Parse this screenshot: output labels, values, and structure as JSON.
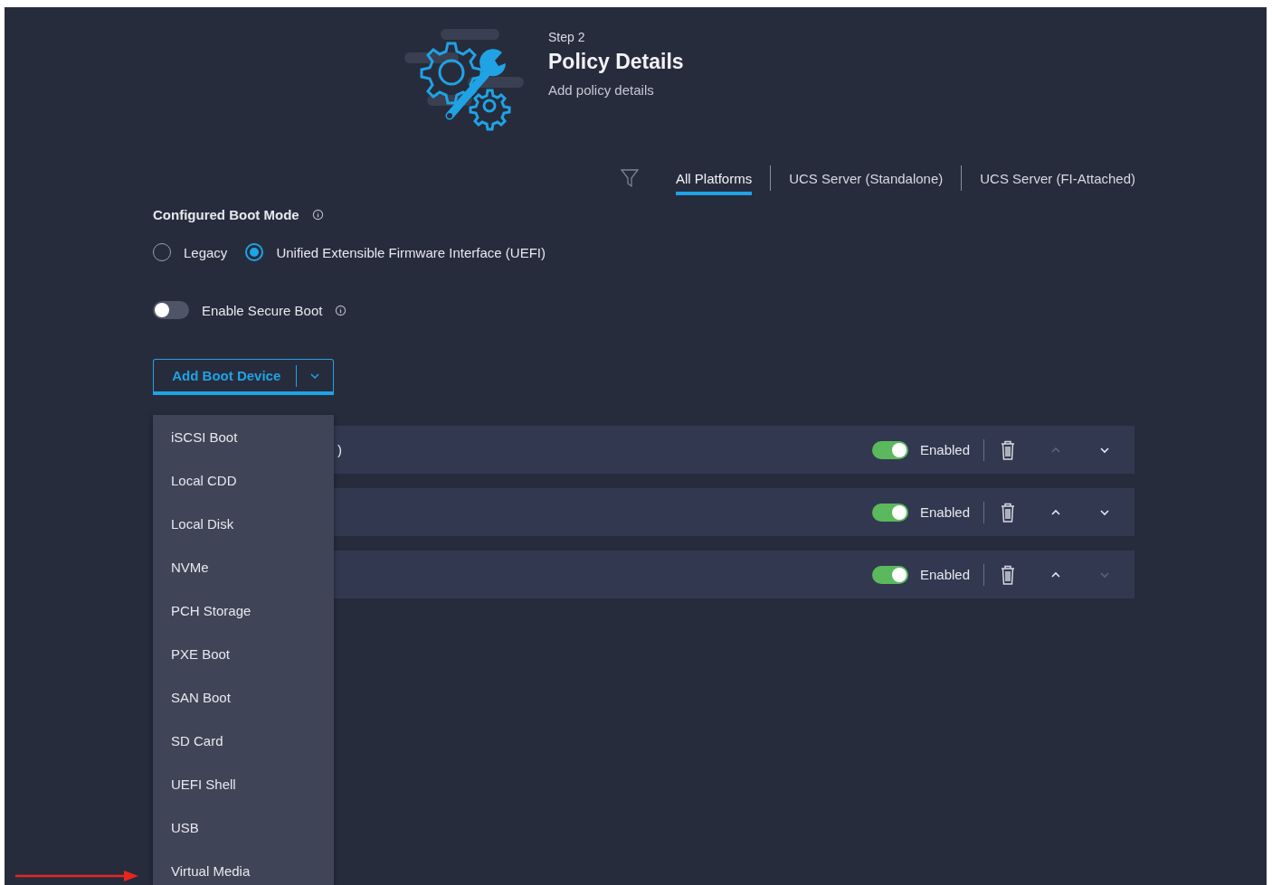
{
  "header": {
    "step": "Step 2",
    "title": "Policy Details",
    "subtitle": "Add policy details"
  },
  "tabs": [
    {
      "label": "All Platforms",
      "selected": true
    },
    {
      "label": "UCS Server (Standalone)",
      "selected": false
    },
    {
      "label": "UCS Server (FI-Attached)",
      "selected": false
    }
  ],
  "boot_mode": {
    "label": "Configured Boot Mode",
    "options": [
      {
        "label": "Legacy",
        "selected": false
      },
      {
        "label": "Unified Extensible Firmware Interface (UEFI)",
        "selected": true
      }
    ]
  },
  "secure_boot": {
    "label": "Enable Secure Boot",
    "on": false
  },
  "add_button": {
    "label": "Add Boot Device",
    "expanded": true
  },
  "menu": [
    {
      "label": "iSCSI Boot"
    },
    {
      "label": "Local CDD"
    },
    {
      "label": "Local Disk"
    },
    {
      "label": "NVMe"
    },
    {
      "label": "PCH Storage"
    },
    {
      "label": "PXE Boot"
    },
    {
      "label": "SAN Boot"
    },
    {
      "label": "SD Card"
    },
    {
      "label": "UEFI Shell"
    },
    {
      "label": "USB"
    },
    {
      "label": "Virtual Media",
      "pointed": true
    }
  ],
  "devices": [
    {
      "label": ")",
      "on": true,
      "state": "Enabled",
      "up_disabled": true,
      "down_disabled": false
    },
    {
      "on": true,
      "state": "Enabled",
      "up_disabled": false,
      "down_disabled": false
    },
    {
      "on": true,
      "state": "Enabled",
      "up_disabled": false,
      "down_disabled": true
    }
  ]
}
